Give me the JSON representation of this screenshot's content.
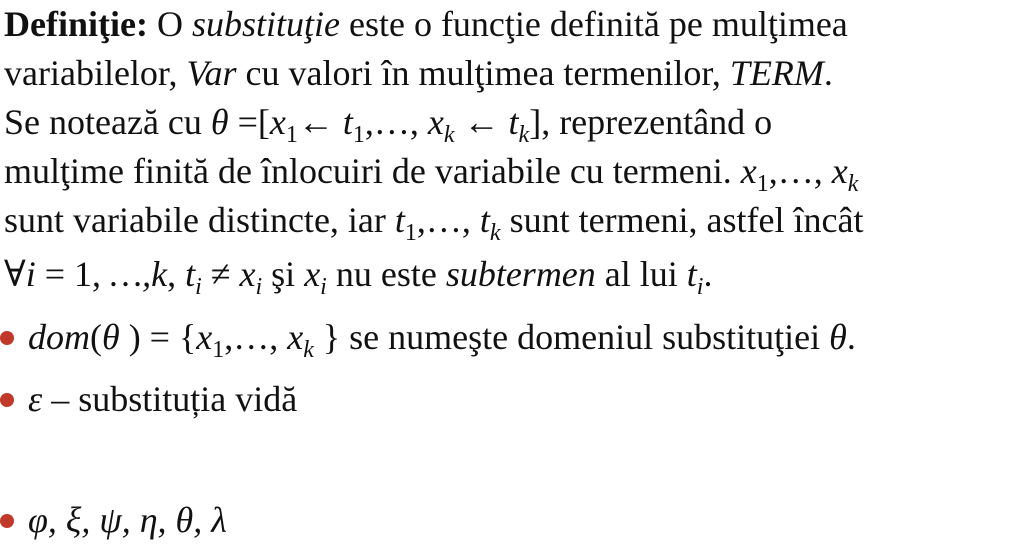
{
  "definition": {
    "heading": "Definiţie:",
    "l1_a": " O ",
    "l1_term": "substituţie",
    "l1_b": " este o funcţie definită pe mulţimea",
    "l2_a": "variabilelor, ",
    "l2_var": "Var",
    "l2_b": " cu valori în mulţimea termenilor, ",
    "l2_term": "TERM",
    "l2_c": ".",
    "l3_a": "Se notează cu ",
    "l3_theta": "θ",
    "l3_eq": " =[",
    "l3_x": "x",
    "l3_sub1": "1",
    "l3_arrow1": "← ",
    "l3_t": "t",
    "l3_sub1b": "1",
    "l3_dots": ",…, ",
    "l3_xk": "x",
    "l3_subk": "k",
    "l3_arrow2": " ← ",
    "l3_tk": "t",
    "l3_subkb": "k",
    "l3_close": "], reprezentând o",
    "l4_a": "mulţime finită de înlocuiri de variabile cu termeni. ",
    "l4_x1": "x",
    "l4_sub1": "1",
    "l4_dots": ",…, ",
    "l4_xk": "x",
    "l4_subk": "k",
    "l5_a": "sunt variabile distincte, iar ",
    "l5_t1": "t",
    "l5_sub1": "1",
    "l5_dots": ",…, ",
    "l5_tk": "t",
    "l5_subk": "k",
    "l5_b": " sunt termeni, astfel încât",
    "l6_forall": "∀",
    "l6_i": "i",
    "l6_eq": " = 1,",
    "l6_range": " …,k",
    "l6_c1": ", ",
    "l6_ti": "t",
    "l6_subi": "i",
    "l6_neq": " ≠ ",
    "l6_xi": "x",
    "l6_subi2": "i",
    "l6_and": " şi ",
    "l6_xi2": "x",
    "l6_subi3": "i",
    "l6_b": " nu este ",
    "l6_subterm": "subtermen",
    "l6_c": " al lui ",
    "l6_ti2": "t",
    "l6_subi4": "i",
    "l6_end": "."
  },
  "bullets": {
    "b1_dom": "dom",
    "b1_open": "(",
    "b1_theta": "θ",
    "b1_close": " ) = {",
    "b1_x1": "x",
    "b1_sub1": "1",
    "b1_dots": ",…, ",
    "b1_xk": "x",
    "b1_subk": "k",
    "b1_text": " } se numeşte domeniul substituţiei ",
    "b1_theta2": "θ",
    "b1_end": ".",
    "b2_eps": "ε",
    "b2_text": " – substituția vidă",
    "b3_symbols": "φ, ξ, ψ, η, θ, λ"
  },
  "colors": {
    "bullet": "#c0392b",
    "text": "#111111"
  }
}
